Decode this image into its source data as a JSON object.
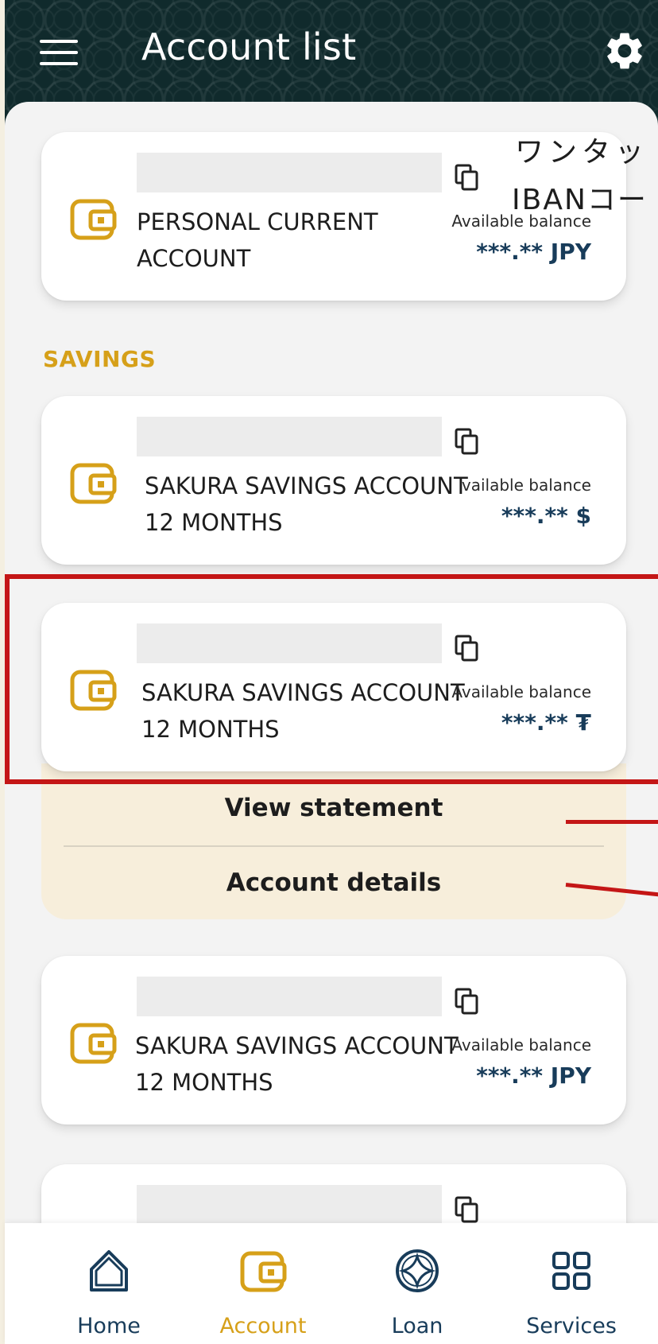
{
  "header": {
    "title": "Account list"
  },
  "overlay_text": {
    "line1": "ワンタッ",
    "line2": "IBANコー"
  },
  "sections": {
    "savings_label": "SAVINGS"
  },
  "cards": [
    {
      "name": "PERSONAL CURRENT ACCOUNT",
      "name_line1": "PERSONAL CURRENT",
      "name_line2": "ACCOUNT",
      "avail_label": "Available balance",
      "balance": "***.** JPY"
    },
    {
      "name_line1": "SAKURA SAVINGS ACCOUNT",
      "name_line2": "12 MONTHS",
      "avail_label": "vailable balance",
      "balance": "***.** $"
    },
    {
      "name_line1": "SAKURA SAVINGS ACCOUNT",
      "name_line2": "12 MONTHS",
      "avail_label": "Available balance",
      "balance": "***.** ₮"
    },
    {
      "name_line1": "SAKURA SAVINGS ACCOUNT",
      "name_line2": "12 MONTHS",
      "avail_label": "Available balance",
      "balance": "***.** JPY"
    }
  ],
  "actions": {
    "view_statement": "View statement",
    "account_details": "Account details"
  },
  "nav": {
    "home": "Home",
    "account": "Account",
    "loan": "Loan",
    "services": "Services"
  },
  "colors": {
    "accent_gold": "#d6a019",
    "navy_text": "#183c5a",
    "header_bg": "#102a2c",
    "annotation_red": "#c41616",
    "action_panel_bg": "#f7eedb"
  },
  "icons": [
    "menu-icon",
    "gear-icon",
    "wallet-icon",
    "copy-icon",
    "home-icon",
    "account-icon",
    "loan-icon",
    "services-icon"
  ]
}
